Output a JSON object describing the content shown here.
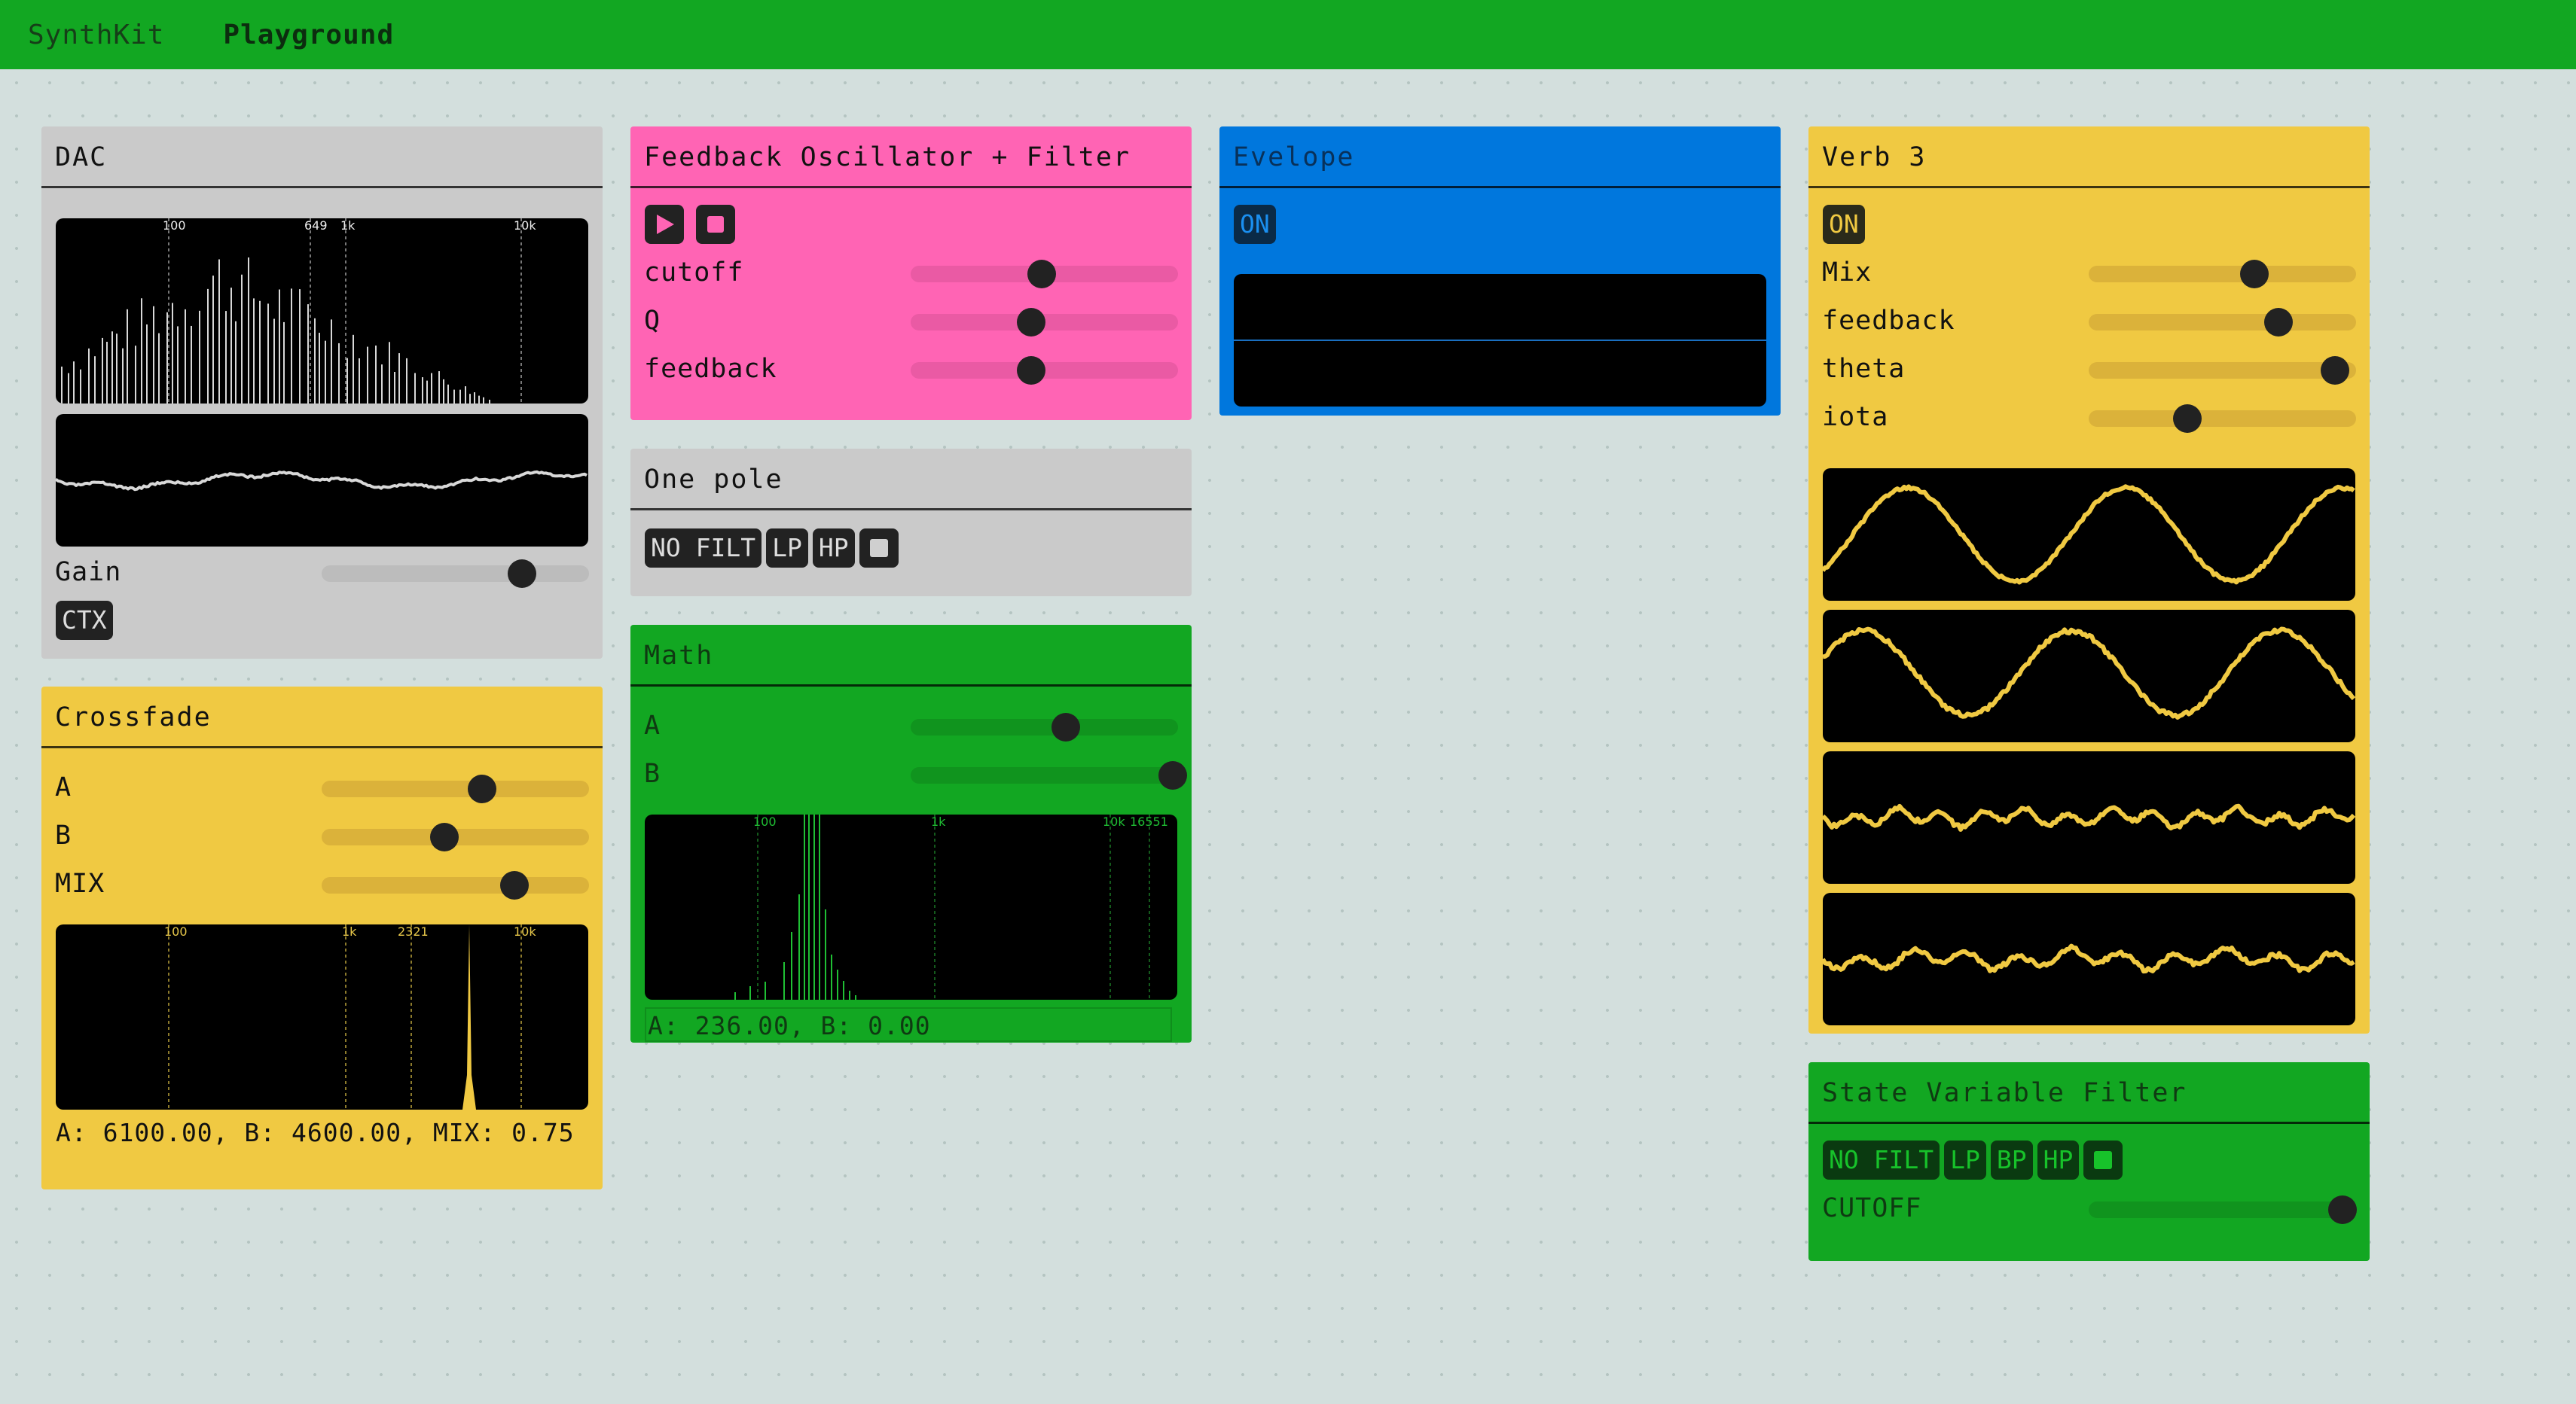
{
  "topbar": {
    "brand": "SynthKit",
    "tab": "Playground"
  },
  "dac": {
    "title": "DAC",
    "spectrum_ticks": [
      "100",
      "649",
      "1k",
      "10k"
    ],
    "gain_label": "Gain",
    "gain_value": 0.75,
    "ctx_label": "CTX"
  },
  "crossfade": {
    "title": "Crossfade",
    "sliders": [
      {
        "label": "A",
        "value": 0.6
      },
      {
        "label": "B",
        "value": 0.46
      },
      {
        "label": "MIX",
        "value": 0.72
      }
    ],
    "spectrum_ticks": [
      "100",
      "1k",
      "2321",
      "10k"
    ],
    "readout": "A: 6100.00, B: 4600.00, MIX: 0.75"
  },
  "feedback_osc": {
    "title": "Feedback Oscillator + Filter",
    "play_icon": "play-icon",
    "stop_icon": "stop-icon",
    "sliders": [
      {
        "label": "cutoff",
        "value": 0.49
      },
      {
        "label": "Q",
        "value": 0.45
      },
      {
        "label": "feedback",
        "value": 0.45
      }
    ]
  },
  "one_pole": {
    "title": "One pole",
    "buttons": [
      "NO FILT",
      "LP",
      "HP"
    ],
    "square_icon": "square-icon"
  },
  "math": {
    "title": "Math",
    "sliders": [
      {
        "label": "A",
        "value": 0.58
      },
      {
        "label": "B",
        "value": 0.98
      }
    ],
    "spectrum_ticks": [
      "100",
      "1k",
      "10k",
      "16551"
    ],
    "readout": "A: 236.00, B: 0.00"
  },
  "envelope": {
    "title": "Evelope",
    "on_label": "ON"
  },
  "verb": {
    "title": "Verb 3",
    "on_label": "ON",
    "sliders": [
      {
        "label": "Mix",
        "value": 0.62
      },
      {
        "label": "feedback",
        "value": 0.71
      },
      {
        "label": "theta",
        "value": 0.92
      },
      {
        "label": "iota",
        "value": 0.37
      }
    ]
  },
  "svf": {
    "title": "State Variable Filter",
    "buttons": [
      "NO FILT",
      "LP",
      "BP",
      "HP"
    ],
    "square_icon": "square-icon",
    "cutoff_label": "CUTOFF",
    "cutoff_value": 0.95
  },
  "colors": {
    "green": "#12a722",
    "pink": "#ff64b4",
    "yellow": "#f0c942",
    "blue": "#0077dd",
    "gray": "#cacaca"
  }
}
